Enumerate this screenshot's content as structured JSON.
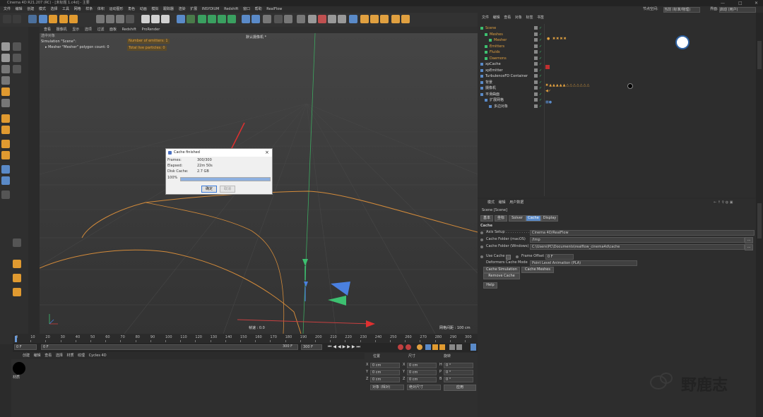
{
  "window": {
    "title": "Cinema 4D R21.207 (RC) - [未标题 1.c4d] - 主要"
  },
  "menubar": {
    "items": [
      "文件",
      "编辑",
      "创建",
      "模式",
      "选择",
      "工具",
      "网格",
      "样条",
      "体积",
      "运动图形",
      "角色",
      "动画",
      "模拟",
      "跟踪器",
      "渲染",
      "扩展",
      "INSYDIUM",
      "Redshift",
      "窗口",
      "帮助",
      "RealFlow"
    ],
    "node_space_label": "节点空间:",
    "node_space_value": "当前 (标准/物理)",
    "layout_label": "界面:",
    "layout_value": "启动 (用户)"
  },
  "viewport": {
    "menu": [
      "查看",
      "摄像机",
      "显示",
      "选项",
      "过滤",
      "面板",
      "Redshift",
      "ProRender"
    ],
    "title": "默认摄像机 *",
    "info_header": "选中对象",
    "info_line1": "Simulation \"Scene\":",
    "info_line2": "▸ Mesher \"Mesher\" polygon count: 0",
    "emitters_label": "Number of emitters: 1",
    "particles_label": "Total live particles: 0",
    "speed_label": "帧速 : 0.0",
    "grid_label": "网格间距 : 100 cm"
  },
  "dialog": {
    "title": "Cache finished",
    "frames_label": "Frames:",
    "frames_value": "300/300",
    "elapsed_label": "Elapsed:",
    "elapsed_value": "22m 50s",
    "disk_label": "Disk Cache:",
    "disk_value": "2.7 GB",
    "progress_label": "100%",
    "progress": 1.0,
    "ok_label": "确定",
    "cancel_label": "取消"
  },
  "timeline": {
    "ticks": [
      "0",
      "10",
      "20",
      "30",
      "40",
      "50",
      "60",
      "70",
      "80",
      "90",
      "100",
      "110",
      "120",
      "130",
      "140",
      "150",
      "160",
      "170",
      "180",
      "190",
      "200",
      "210",
      "220",
      "230",
      "240",
      "250",
      "260",
      "270",
      "280",
      "290",
      "300"
    ],
    "current_frame": "0 F",
    "start_field": "0 F",
    "start_field2": "0 F",
    "end_field": "300 F",
    "end_field2": "300 F"
  },
  "materials": {
    "menu": [
      "创建",
      "编辑",
      "查看",
      "选择",
      "材质",
      "纹理",
      "Cycles 4D"
    ],
    "items": [
      {
        "name": "材质"
      }
    ]
  },
  "coords": {
    "headers": [
      "位置",
      "尺寸",
      "旋转"
    ],
    "rows": [
      {
        "axis": "X",
        "pos": "0 cm",
        "size_axis": "X",
        "size": "0 cm",
        "rot_axis": "H",
        "rot": "0 °"
      },
      {
        "axis": "Y",
        "pos": "0 cm",
        "size_axis": "Y",
        "size": "0 cm",
        "rot_axis": "P",
        "rot": "0 °"
      },
      {
        "axis": "Z",
        "pos": "0 cm",
        "size_axis": "Z",
        "size": "0 cm",
        "rot_axis": "B",
        "rot": "0 °"
      }
    ],
    "mode1": "对象 (相对)",
    "mode2": "绝对尺寸",
    "apply_label": "应用"
  },
  "object_manager": {
    "menu": [
      "文件",
      "编辑",
      "查看",
      "对象",
      "标签",
      "书签"
    ],
    "objects": [
      {
        "name": "Scene",
        "color": "#e0a040",
        "indent": 0
      },
      {
        "name": "Meshes",
        "color": "#e0a040",
        "indent": 1
      },
      {
        "name": "Mesher",
        "color": "#e0a040",
        "indent": 2
      },
      {
        "name": "Emitters",
        "color": "#e0a040",
        "indent": 1
      },
      {
        "name": "Fluids",
        "color": "#e0a040",
        "indent": 1
      },
      {
        "name": "Daemons",
        "color": "#e0a040",
        "indent": 1
      },
      {
        "name": "xpCache",
        "color": "#d8d8d8",
        "indent": 0
      },
      {
        "name": "xpEmitter",
        "color": "#d8d8d8",
        "indent": 0
      },
      {
        "name": "TurbulenceFD Container",
        "color": "#d8d8d8",
        "indent": 0
      },
      {
        "name": "背景",
        "color": "#d8d8d8",
        "indent": 0
      },
      {
        "name": "摄像机",
        "color": "#d8d8d8",
        "indent": 0
      },
      {
        "name": "平滑曲面",
        "color": "#d8d8d8",
        "indent": 0
      },
      {
        "name": "扩展网格",
        "color": "#d8d8d8",
        "indent": 1
      },
      {
        "name": "多边对象",
        "color": "#d8d8d8",
        "indent": 2
      }
    ]
  },
  "attributes": {
    "menu": [
      "模式",
      "编辑",
      "用户数据"
    ],
    "object_title": "Scene [Scene]",
    "tabs": [
      "基本",
      "坐标",
      "Solver",
      "Cache",
      "Display"
    ],
    "active_tab": "Cache",
    "section": "Cache",
    "axis_setup_label": "Axis Setup . . . . . . . . . . .",
    "axis_setup_value": "Cinema 4D/RealFlow",
    "cache_mac_label": "Cache Folder (macOS)",
    "cache_mac_value": "/tmp",
    "cache_win_label": "Cache Folder (Windows)",
    "cache_win_value": "C:\\Users\\PC\\Documents\\realflow_cinema4d\\cache",
    "use_cache_label": "Use Cache",
    "frame_offset_label": "Frame Offset",
    "frame_offset_value": "0 F",
    "deformers_label": "Deformers Cache Mode",
    "deformers_value": "Point Level Animation (PLA)",
    "buttons": [
      "Cache Simulation",
      "Cache Meshes",
      "Remove Cache",
      "Help"
    ]
  },
  "watermark": {
    "text": "野鹿志"
  },
  "colors": {
    "accent": "#5a8ac8",
    "orange": "#e0a040",
    "curve": "#d28a3a"
  }
}
